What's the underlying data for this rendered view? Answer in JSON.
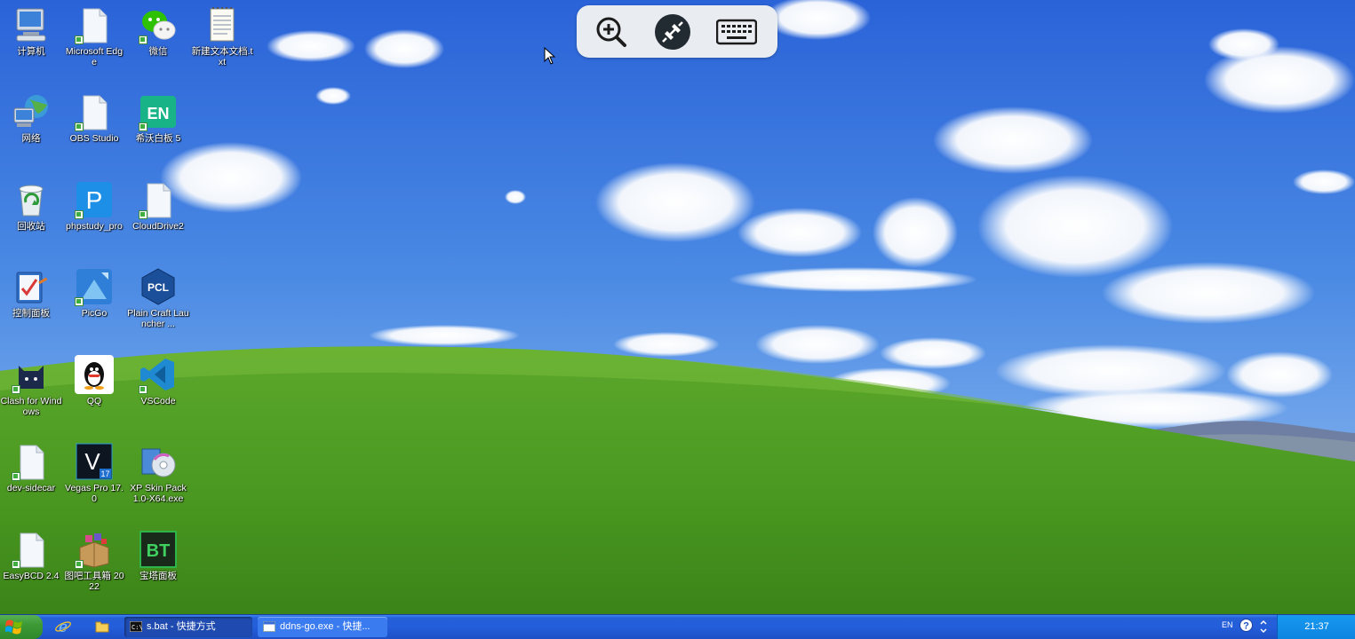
{
  "desktop": {
    "icons": [
      {
        "label": "计算机",
        "icon": "computer-icon"
      },
      {
        "label": "Microsoft Edge",
        "icon": "file-icon"
      },
      {
        "label": "微信",
        "icon": "wechat-icon"
      },
      {
        "label": "新建文本文档.txt",
        "icon": "notepad-icon"
      },
      {
        "label": "网络",
        "icon": "network-icon"
      },
      {
        "label": "OBS Studio",
        "icon": "file-icon"
      },
      {
        "label": "希沃白板 5",
        "icon": "en-board-icon"
      },
      {
        "label": "回收站",
        "icon": "recycle-bin-icon"
      },
      {
        "label": "phpstudy_pro",
        "icon": "phpstudy-icon"
      },
      {
        "label": "CloudDrive2",
        "icon": "file-icon"
      },
      {
        "label": "控制面板",
        "icon": "control-panel-icon"
      },
      {
        "label": "PicGo",
        "icon": "picgo-icon"
      },
      {
        "label": "Plain Craft Launcher ...",
        "icon": "pcl-icon"
      },
      {
        "label": "Clash for Windows",
        "icon": "clash-cat-icon"
      },
      {
        "label": "QQ",
        "icon": "qq-penguin-icon"
      },
      {
        "label": "VSCode",
        "icon": "vscode-icon"
      },
      {
        "label": "dev-sidecar",
        "icon": "file-icon"
      },
      {
        "label": "Vegas Pro 17.0",
        "icon": "vegas-icon"
      },
      {
        "label": "XP Skin Pack 1.0-X64.exe",
        "icon": "installer-disc-icon"
      },
      {
        "label": "EasyBCD 2.4",
        "icon": "file-icon"
      },
      {
        "label": "图吧工具箱 2022",
        "icon": "toolbox-icon"
      },
      {
        "label": "宝塔面板",
        "icon": "bt-panel-icon"
      }
    ]
  },
  "remote_toolbar": {
    "buttons": [
      "zoom-in-icon",
      "remote-connection-icon",
      "keyboard-icon"
    ]
  },
  "taskbar": {
    "start_icon": "windows-logo-icon",
    "quick_launch": [
      "internet-explorer-icon",
      "folder-icon"
    ],
    "tasks": [
      {
        "label": "s.bat - 快捷方式",
        "icon": "cmd-icon",
        "active": true
      },
      {
        "label": "ddns-go.exe - 快捷...",
        "icon": "window-icon",
        "active": false
      }
    ],
    "tray": {
      "language": "EN",
      "help_icon": "help-icon",
      "clock": "21:37"
    }
  },
  "colors": {
    "sky": "#3f7fe0",
    "grass": "#4f9a28",
    "taskbar": "#245edb",
    "start_button": "#3c9a35",
    "tray": "#0f8ae6"
  }
}
